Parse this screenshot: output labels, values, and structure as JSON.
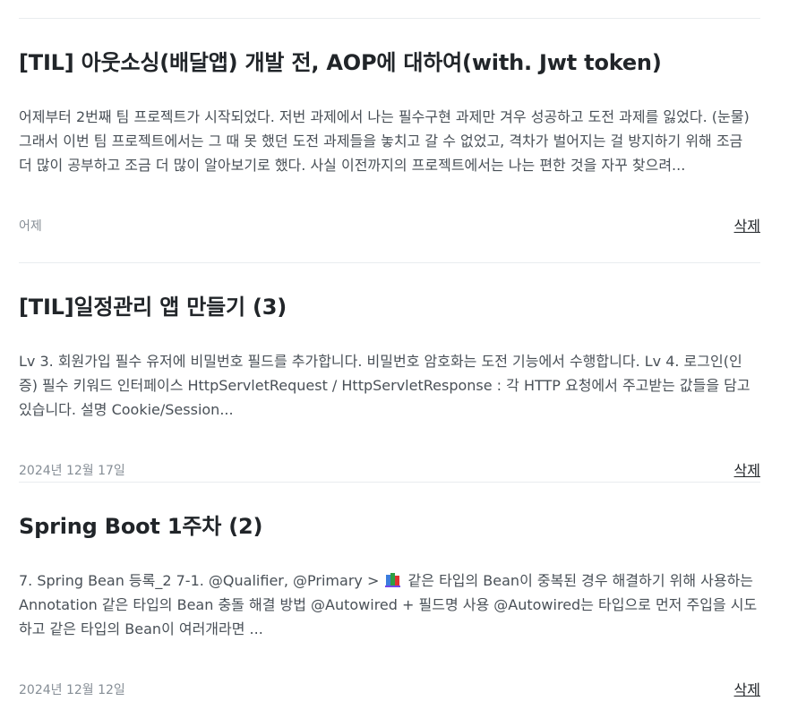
{
  "posts": [
    {
      "title": "[TIL] 아웃소싱(배달앱) 개발 전, AOP에 대하여(with. Jwt token)",
      "excerpt": "어제부터 2번째 팀 프로젝트가 시작되었다. 저번 과제에서 나는 필수구현 과제만 겨우 성공하고 도전 과제를 잃었다. (눈물) 그래서 이번 팀 프로젝트에서는 그 때 못 했던 도전 과제들을 놓치고 갈 수 없었고, 격차가 벌어지는 걸 방지하기 위해 조금 더 많이 공부하고 조금 더 많이 알아보기로 했다. 사실 이전까지의 프로젝트에서는 나는 편한 것을 자꾸 찾으려...",
      "date": "어제",
      "delete_label": "삭제"
    },
    {
      "title": "[TIL]일정관리 앱 만들기 (3)",
      "excerpt": "Lv 3. 회원가입 필수 유저에 비밀번호 필드를 추가합니다. 비밀번호 암호화는 도전 기능에서 수행합니다. Lv 4. 로그인(인증) 필수 키워드 인터페이스 HttpServletRequest / HttpServletResponse : 각 HTTP 요청에서 주고받는 값들을 담고 있습니다. 설명 Cookie/Session...",
      "date": "2024년 12월 17일",
      "delete_label": "삭제"
    },
    {
      "title": "Spring Boot 1주차 (2)",
      "excerpt_before_icon": "7. Spring Bean 등록_2 7-1. @Qualifier, @Primary > ",
      "excerpt_icon": "books-emoji-icon",
      "excerpt_after_icon": " 같은 타입의 Bean이 중복된 경우 해결하기 위해 사용하는 Annotation 같은 타입의 Bean 충돌 해결 방법 @Autowired + 필드명 사용 @Autowired는 타입으로 먼저 주입을 시도하고 같은 타입의 Bean이 여러개라면 ...",
      "date": "2024년 12월 12일",
      "delete_label": "삭제"
    }
  ],
  "colors": {
    "title": "#212529",
    "excerpt": "#495057",
    "date": "#868e96",
    "divider": "#e9ecef"
  }
}
